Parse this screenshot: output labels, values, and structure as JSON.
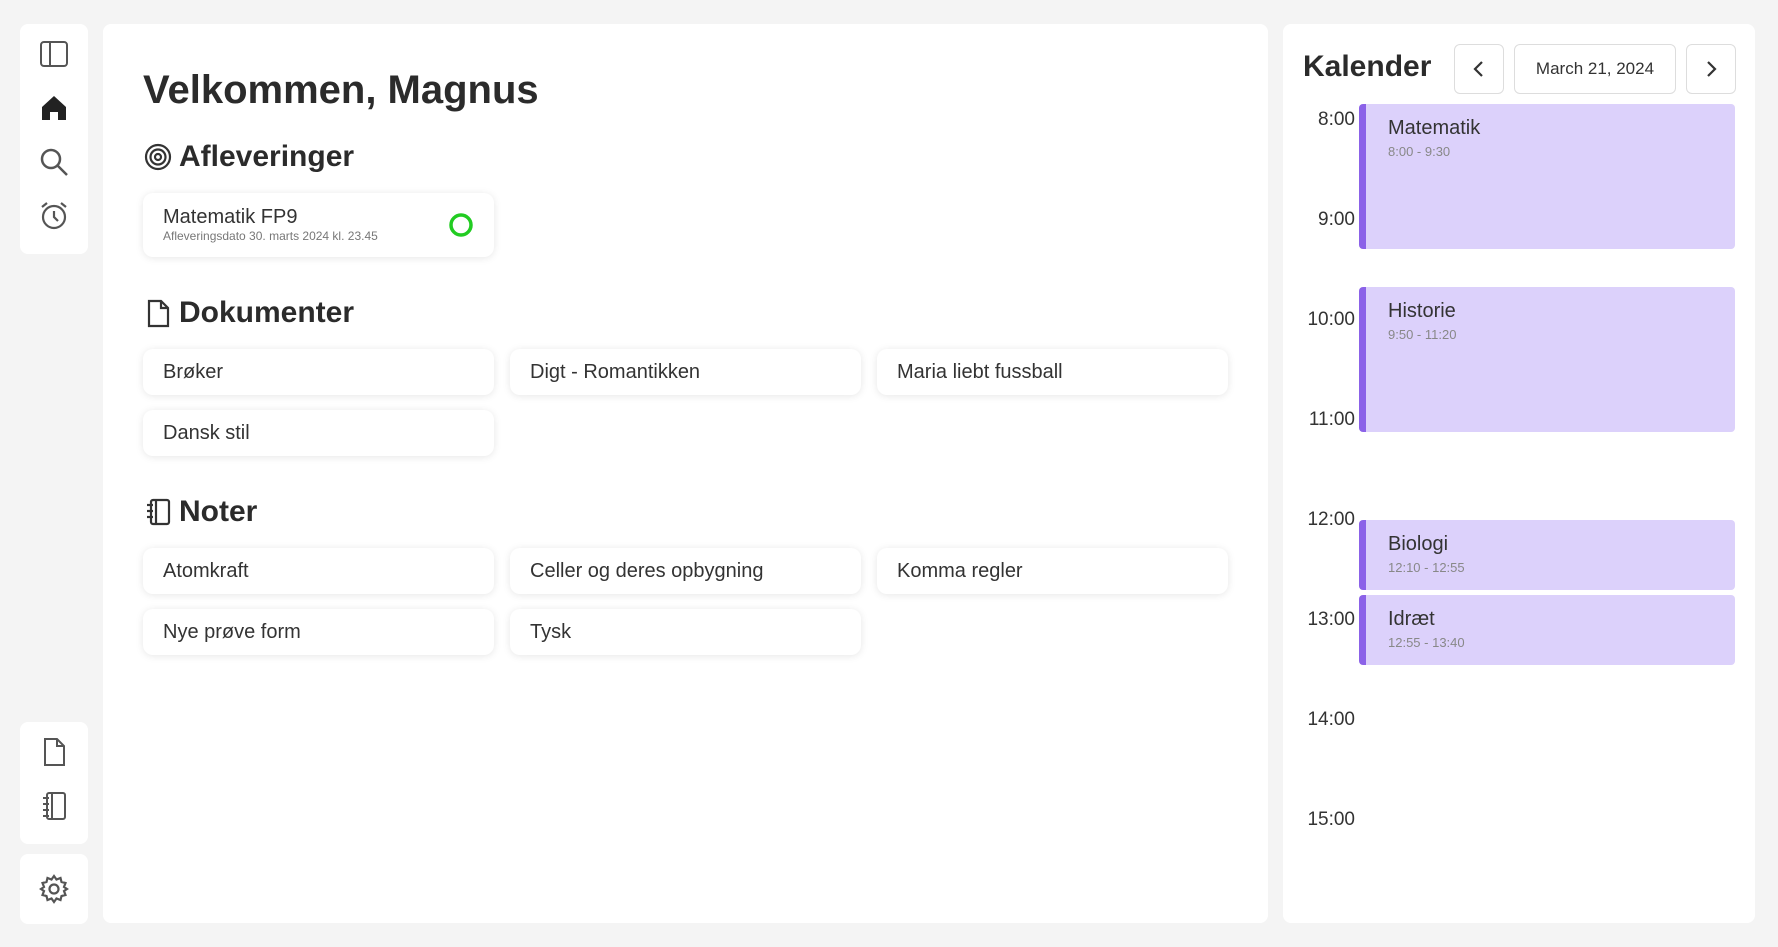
{
  "sidebar": {
    "top_icons": [
      "sidebar-toggle-icon",
      "home-icon",
      "search-icon",
      "alarm-clock-icon"
    ],
    "bottom_icons": [
      "document-icon",
      "notebook-icon"
    ],
    "settings_icon": "gear-icon"
  },
  "main": {
    "welcome": "Velkommen, Magnus",
    "assignments": {
      "heading": "Afleveringer",
      "items": [
        {
          "title": "Matematik FP9",
          "due": "Afleveringsdato 30. marts 2024 kl. 23.45"
        }
      ]
    },
    "documents": {
      "heading": "Dokumenter",
      "items": [
        "Brøker",
        "Digt - Romantikken",
        "Maria liebt fussball",
        "Dansk stil"
      ]
    },
    "notes": {
      "heading": "Noter",
      "items": [
        "Atomkraft",
        "Celler og deres opbygning",
        "Komma regler",
        "Nye prøve form",
        "Tysk"
      ]
    }
  },
  "calendar": {
    "title": "Kalender",
    "date": "March 21, 2024",
    "hours": [
      "8:00",
      "9:00",
      "10:00",
      "11:00",
      "12:00",
      "13:00",
      "14:00",
      "15:00"
    ],
    "events": [
      {
        "title": "Matematik",
        "time": "8:00 - 9:30"
      },
      {
        "title": "Historie",
        "time": "9:50 - 11:20"
      },
      {
        "title": "Biologi",
        "time": "12:10 - 12:55"
      },
      {
        "title": "Idræt",
        "time": "12:55 - 13:40"
      }
    ],
    "colors": {
      "event_fill": "#dcd1fb",
      "event_border": "#8b62e8",
      "progress": "#22cc22"
    }
  }
}
